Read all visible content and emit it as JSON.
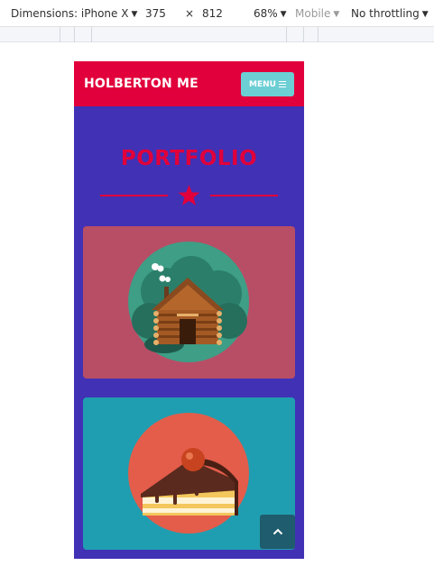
{
  "devtools": {
    "dimensions_label": "Dimensions: iPhone X",
    "width": "375",
    "times": "×",
    "height": "812",
    "zoom": "68%",
    "device_type": "Mobile",
    "throttling": "No throttling"
  },
  "site": {
    "brand": "HOLBERTON ME",
    "menu_label": "MENU",
    "section_title": "PORTFOLIO"
  },
  "portfolio": {
    "items": [
      {
        "icon": "log-cabin-icon",
        "background": "#b84e66"
      },
      {
        "icon": "cake-slice-icon",
        "background": "#209eb1"
      }
    ]
  },
  "colors": {
    "accent": "#e1003b",
    "page_background": "#4131b5",
    "menu_button": "#6ccfd4",
    "back_to_top": "#1f5c6d"
  }
}
